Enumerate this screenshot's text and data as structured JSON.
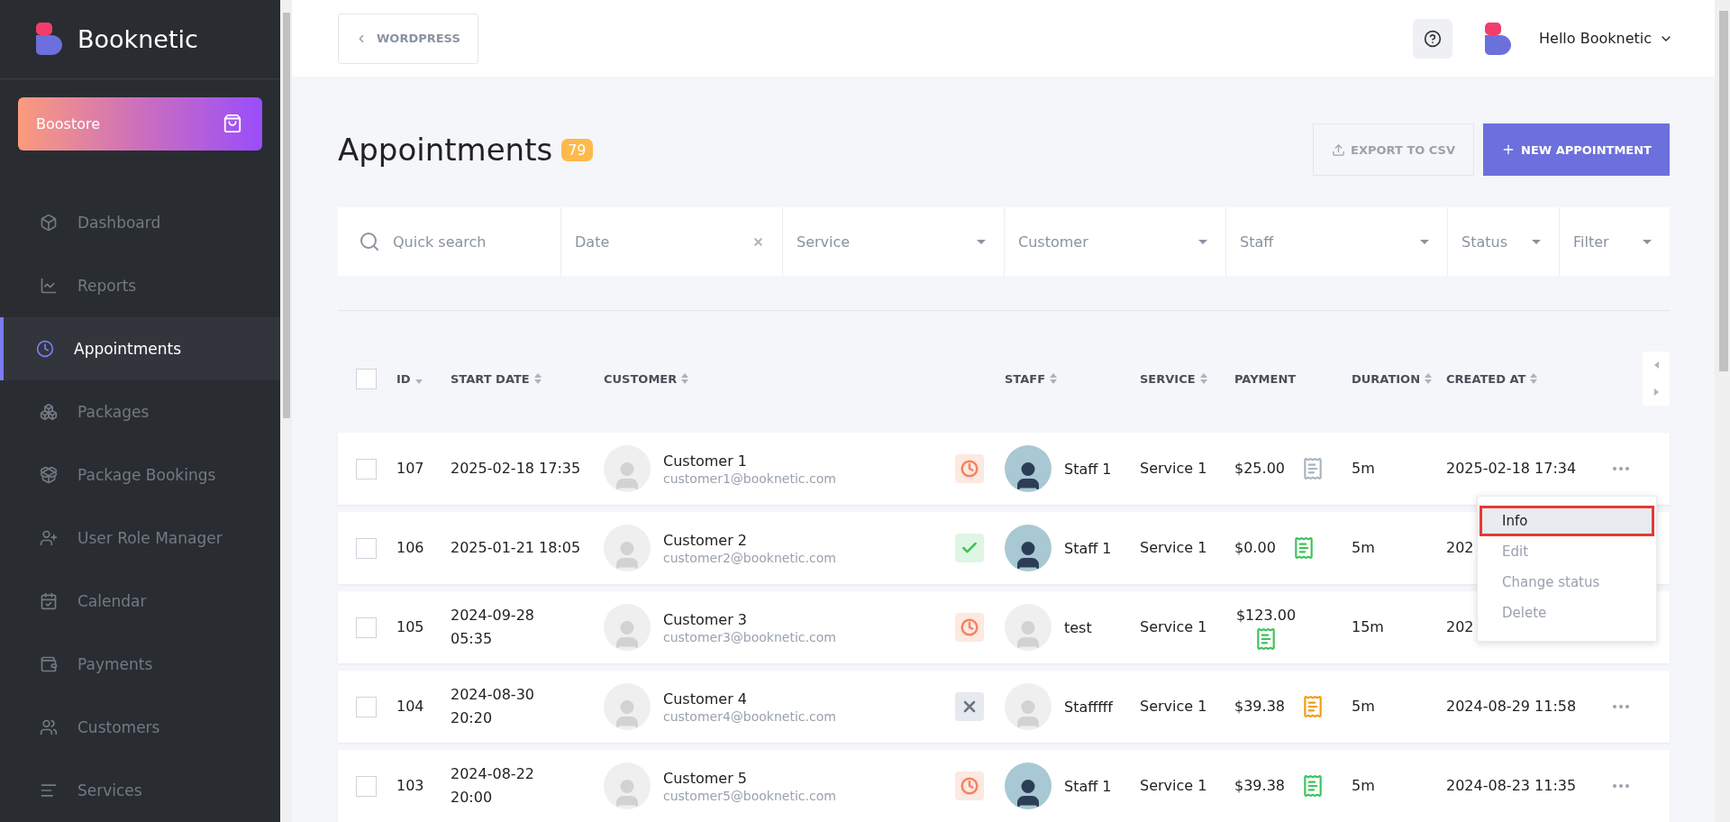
{
  "sidebar": {
    "brand": "Booknetic",
    "store": "Boostore",
    "items": [
      {
        "label": "Dashboard",
        "selected": false
      },
      {
        "label": "Reports",
        "selected": false
      },
      {
        "label": "Appointments",
        "selected": true
      },
      {
        "label": "Packages",
        "selected": false
      },
      {
        "label": "Package Bookings",
        "selected": false
      },
      {
        "label": "User Role Manager",
        "selected": false
      },
      {
        "label": "Calendar",
        "selected": false
      },
      {
        "label": "Payments",
        "selected": false
      },
      {
        "label": "Customers",
        "selected": false
      },
      {
        "label": "Services",
        "selected": false
      }
    ]
  },
  "topbar": {
    "back": "WORDPRESS",
    "user": "Hello Booknetic"
  },
  "page": {
    "title": "Appointments",
    "count": "79",
    "export": "EXPORT TO CSV",
    "create": "NEW APPOINTMENT"
  },
  "filters": [
    {
      "kind": "search",
      "placeholder": "Quick search"
    },
    {
      "kind": "clear",
      "placeholder": "Date"
    },
    {
      "kind": "select",
      "placeholder": "Service"
    },
    {
      "kind": "select",
      "placeholder": "Customer"
    },
    {
      "kind": "select",
      "placeholder": "Staff"
    },
    {
      "kind": "select",
      "placeholder": "Status"
    },
    {
      "kind": "select",
      "placeholder": "Filter"
    }
  ],
  "table": {
    "select_all": {
      "checked": false
    },
    "columns": [
      {
        "label": "ID",
        "kind": "sorted"
      },
      {
        "label": "START DATE",
        "kind": "sortable"
      },
      {
        "label": "CUSTOMER",
        "kind": "sortable"
      },
      {
        "label": "STAFF",
        "kind": "sortable"
      },
      {
        "label": "SERVICE",
        "kind": "sortable"
      },
      {
        "label": "PAYMENT",
        "kind": "plain"
      },
      {
        "label": "DURATION",
        "kind": "sortable"
      },
      {
        "label": "CREATED AT",
        "kind": "sortable"
      }
    ],
    "rows": [
      {
        "checked": false,
        "id": "107",
        "start": "2025-02-18 17:35",
        "customer": "Customer 1",
        "email": "customer1@booknetic.com",
        "kind": "pending",
        "staff": "Staff 1",
        "staff_photo": true,
        "service": "Service 1",
        "amount": "$25.00",
        "color": "#a9b4bf",
        "duration": "5m",
        "created": "2025-02-18 17:34",
        "menu": true
      },
      {
        "checked": false,
        "id": "106",
        "start": "2025-01-21 18:05",
        "customer": "Customer 2",
        "email": "customer2@booknetic.com",
        "kind": "approved",
        "staff": "Staff 1",
        "staff_photo": true,
        "service": "Service 1",
        "amount": "$0.00",
        "color": "#3cc35a",
        "duration": "5m",
        "created": "202",
        "menu": false
      },
      {
        "checked": false,
        "id": "105",
        "start": "2024-09-28 05:35",
        "customer": "Customer 3",
        "email": "customer3@booknetic.com",
        "kind": "pending",
        "staff": "test",
        "staff_photo": false,
        "service": "Service 1",
        "amount": "$123.00",
        "color": "#3cc35a",
        "duration": "15m",
        "created": "202",
        "menu": false
      },
      {
        "checked": false,
        "id": "104",
        "start": "2024-08-30 20:20",
        "customer": "Customer 4",
        "email": "customer4@booknetic.com",
        "kind": "canceled",
        "staff": "Stafffff",
        "staff_photo": false,
        "service": "Service 1",
        "amount": "$39.38",
        "color": "#f39c12",
        "duration": "5m",
        "created": "2024-08-29 11:58",
        "menu": true
      },
      {
        "checked": false,
        "id": "103",
        "start": "2024-08-22 20:00",
        "customer": "Customer 5",
        "email": "customer5@booknetic.com",
        "kind": "pending",
        "staff": "Staff 1",
        "staff_photo": true,
        "service": "Service 1",
        "amount": "$39.38",
        "color": "#3cc35a",
        "duration": "5m",
        "created": "2024-08-23 11:35",
        "menu": true
      }
    ]
  },
  "context_menu": [
    {
      "label": "Info",
      "selected": true
    },
    {
      "label": "Edit",
      "selected": false
    },
    {
      "label": "Change status",
      "selected": false
    },
    {
      "label": "Delete",
      "selected": false
    }
  ]
}
